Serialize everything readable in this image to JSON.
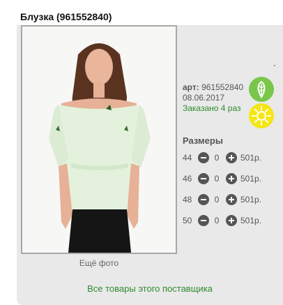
{
  "product": {
    "title": "Блузка (961552840)",
    "art_label": "арт:",
    "art_number": "961552840",
    "date": "08.06.2017",
    "ordered": "Заказано 4 раз"
  },
  "icons": {
    "eco": "leaf-icon",
    "sun": "sun-icon",
    "accent_green": "#7ac64b",
    "accent_yellow": "#f5e614"
  },
  "photo": {
    "more_label": "Ещё фото"
  },
  "sizes": {
    "heading": "Размеры",
    "rows": [
      {
        "size": "44",
        "qty": "0",
        "price": "501р."
      },
      {
        "size": "46",
        "qty": "0",
        "price": "501р."
      },
      {
        "size": "48",
        "qty": "0",
        "price": "501р."
      },
      {
        "size": "50",
        "qty": "0",
        "price": "501р."
      }
    ]
  },
  "supplier_link": "Все товары этого поставщика"
}
